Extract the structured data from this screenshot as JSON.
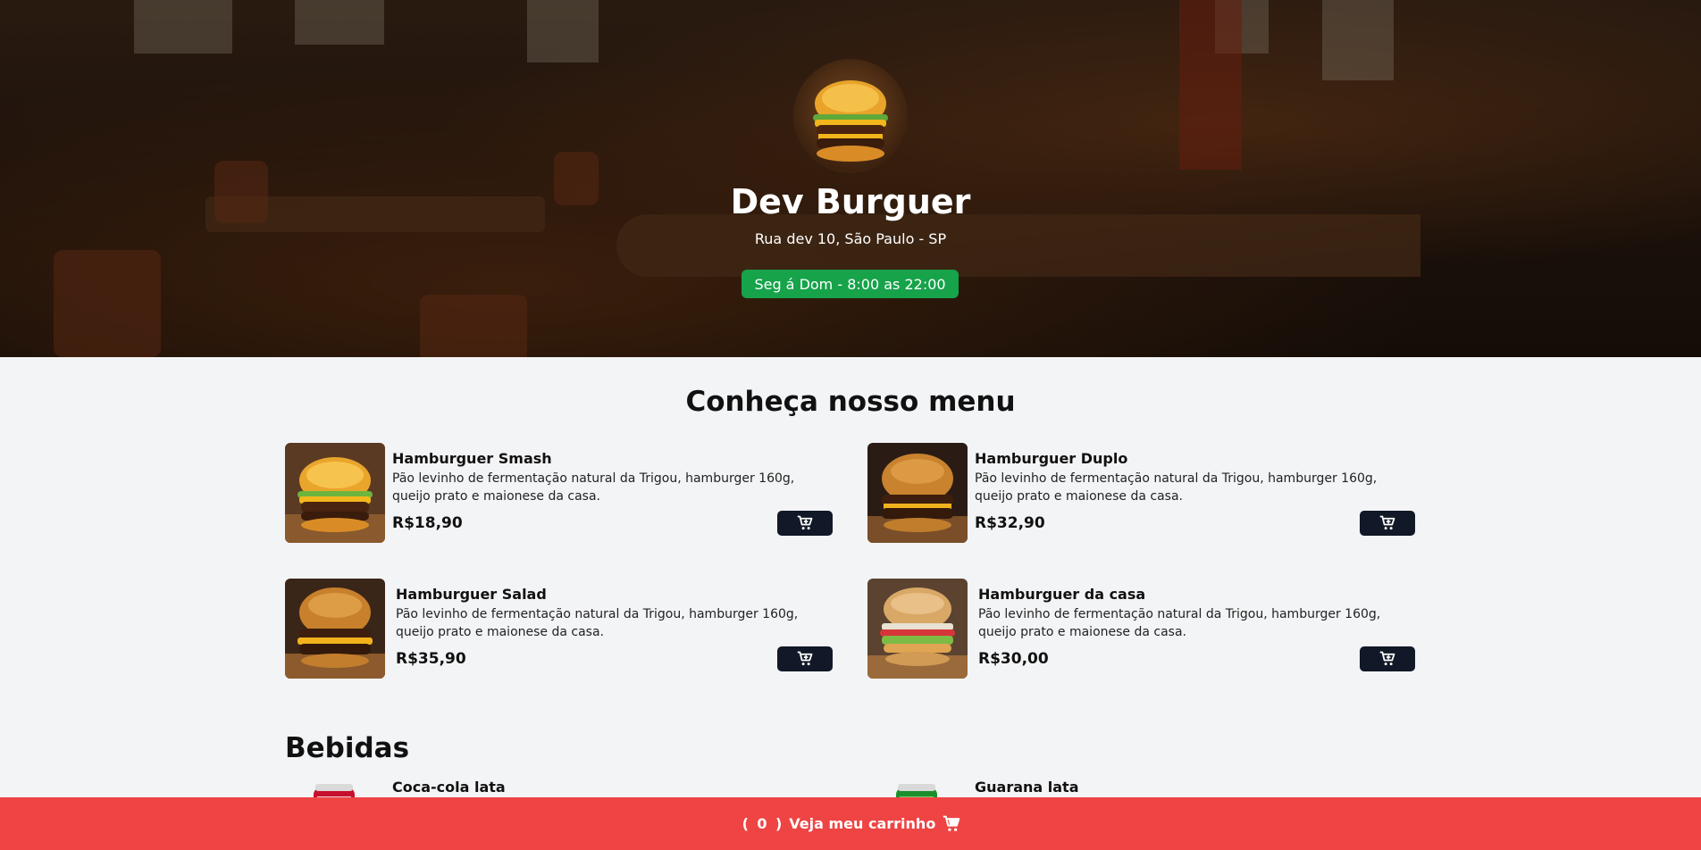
{
  "header": {
    "restaurant_name": "Dev Burguer",
    "address": "Rua dev 10, São Paulo - SP",
    "hours": "Seg á Dom - 8:00 as 22:00",
    "hours_badge_color": "#16a34a"
  },
  "menu": {
    "title": "Conheça nosso menu",
    "items": [
      {
        "name": "Hamburguer Smash",
        "description": "Pão levinho de fermentação natural da Trigou, hamburger 160g, queijo prato e maionese da casa.",
        "price": "R$18,90",
        "icon": "cart-plus-icon"
      },
      {
        "name": "Hamburguer Duplo",
        "description": "Pão levinho de fermentação natural da Trigou, hamburger 160g, queijo prato e maionese da casa.",
        "price": "R$32,90",
        "icon": "cart-plus-icon"
      },
      {
        "name": "Hamburguer Salad",
        "description": "Pão levinho de fermentação natural da Trigou, hamburger 160g, queijo prato e maionese da casa.",
        "price": "R$35,90",
        "icon": "cart-plus-icon"
      },
      {
        "name": "Hamburguer da casa",
        "description": "Pão levinho de fermentação natural da Trigou, hamburger 160g, queijo prato e maionese da casa.",
        "price": "R$30,00",
        "icon": "cart-plus-icon"
      }
    ]
  },
  "drinks": {
    "title": "Bebidas",
    "items": [
      {
        "name": "Coca-cola lata"
      },
      {
        "name": "Guarana lata"
      }
    ]
  },
  "footer": {
    "open_paren": "(",
    "cart_count": "0",
    "close_paren": ")",
    "label": "Veja meu carrinho",
    "icon": "cart-icon",
    "background_color": "#ef4444"
  },
  "colors": {
    "button_dark": "#111827",
    "page_background": "#f3f4f6"
  }
}
